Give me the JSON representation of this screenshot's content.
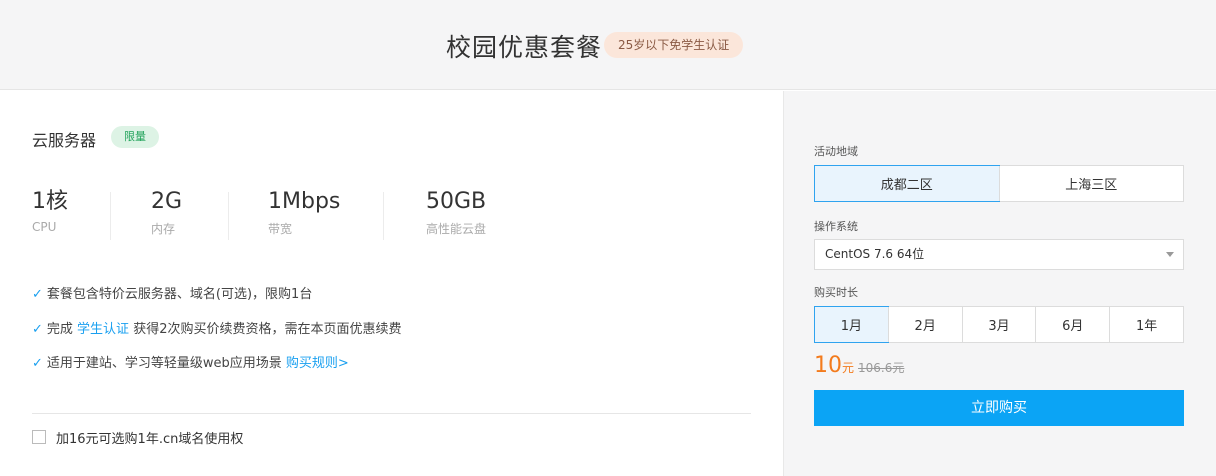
{
  "header": {
    "title": "校园优惠套餐",
    "badge": "25岁以下免学生认证"
  },
  "product": {
    "title": "云服务器",
    "badge": "限量",
    "specs": [
      {
        "value": "1核",
        "label": "CPU"
      },
      {
        "value": "2G",
        "label": "内存"
      },
      {
        "value": "1Mbps",
        "label": "带宽"
      },
      {
        "value": "50GB",
        "label": "高性能云盘"
      }
    ],
    "features": [
      {
        "pre": "套餐包含特价云服务器、域名(可选)，限购1台",
        "link": "",
        "post": ""
      },
      {
        "pre": "完成 ",
        "link": "学生认证",
        "post": " 获得2次购买价续费资格，需在本页面优惠续费"
      },
      {
        "pre": "适用于建站、学习等轻量级web应用场景 ",
        "link": "购买规则>",
        "post": ""
      }
    ],
    "check_icon": "check-icon",
    "addon": "加16元可选购1年.cn域名使用权"
  },
  "config": {
    "region_label": "活动地域",
    "regions": [
      "成都二区",
      "上海三区"
    ],
    "region_selected": "成都二区",
    "os_label": "操作系统",
    "os_value": "CentOS 7.6 64位",
    "duration_label": "购买时长",
    "durations": [
      "1月",
      "2月",
      "3月",
      "6月",
      "1年"
    ],
    "duration_selected": "1月",
    "price": {
      "value": "10",
      "unit": "元",
      "original": "106.6元"
    },
    "buy_label": "立即购买"
  },
  "colors": {
    "accent": "#1aa0f0",
    "price": "#f37b1d",
    "button": "#0ba4f5",
    "limit_badge": "#22a35b"
  }
}
